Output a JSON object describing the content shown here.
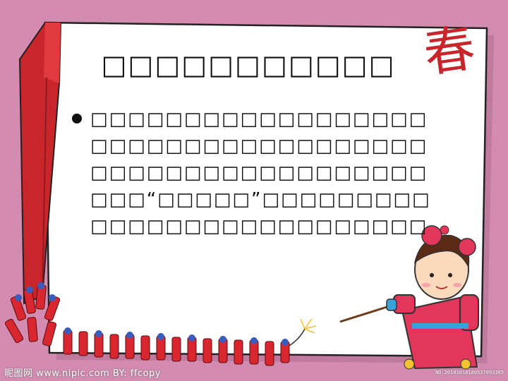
{
  "slide": {
    "title": "□□□□□□□□□□□",
    "bullet_text": "□□□□□□□□□□□□□□□□□□□□□□□□□□□□□□□□□□□□□□□□□□□□□□□□□□□□□□□□□“□□□□□”□□□□□□□□□□□□□□□□□□□□□□□□□□□□□□□□□□□□",
    "decor_char": "春"
  },
  "watermark": {
    "left": "昵图网 www.nipic.com   BY: ffcopy",
    "right": "NO:20101018180537093365"
  },
  "colors": {
    "background": "#d38bb0",
    "card": "#ffffff",
    "ribbon": "#c9262c",
    "accent": "#c9262c"
  }
}
